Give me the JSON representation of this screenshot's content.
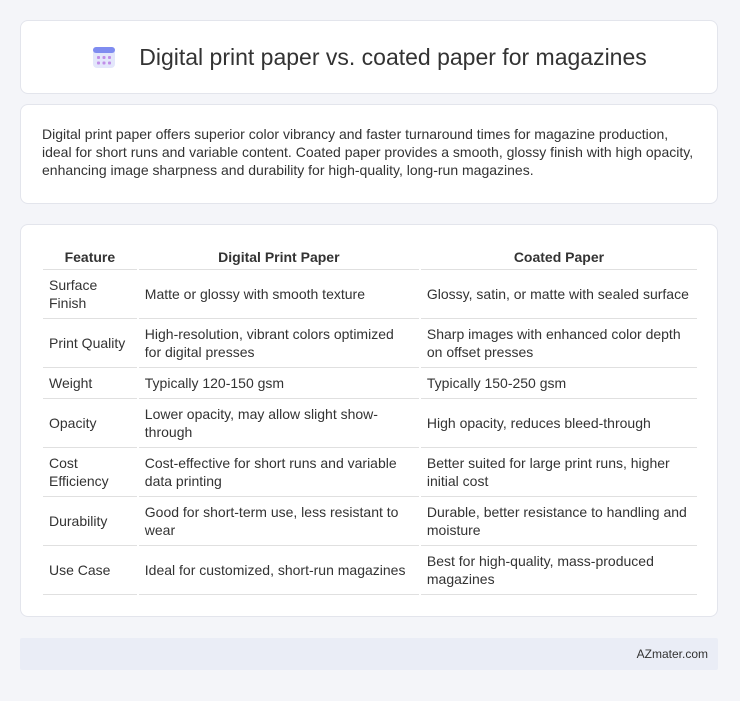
{
  "header": {
    "icon": "calendar-grid-icon",
    "title": "Digital print paper vs. coated paper for magazines"
  },
  "summary": {
    "text": "Digital print paper offers superior color vibrancy and faster turnaround times for magazine production, ideal for short runs and variable content. Coated paper provides a smooth, glossy finish with high opacity, enhancing image sharpness and durability for high-quality, long-run magazines."
  },
  "table": {
    "headers": [
      "Feature",
      "Digital Print Paper",
      "Coated Paper"
    ],
    "rows": [
      [
        "Surface Finish",
        "Matte or glossy with smooth texture",
        "Glossy, satin, or matte with sealed surface"
      ],
      [
        "Print Quality",
        "High-resolution, vibrant colors optimized for digital presses",
        "Sharp images with enhanced color depth on offset presses"
      ],
      [
        "Weight",
        "Typically 120-150 gsm",
        "Typically 150-250 gsm"
      ],
      [
        "Opacity",
        "Lower opacity, may allow slight show-through",
        "High opacity, reduces bleed-through"
      ],
      [
        "Cost Efficiency",
        "Cost-effective for short runs and variable data printing",
        "Better suited for large print runs, higher initial cost"
      ],
      [
        "Durability",
        "Good for short-term use, less resistant to wear",
        "Durable, better resistance to handling and moisture"
      ],
      [
        "Use Case",
        "Ideal for customized, short-run magazines",
        "Best for high-quality, mass-produced magazines"
      ]
    ]
  },
  "footer": {
    "brand": "AZmater.com"
  }
}
